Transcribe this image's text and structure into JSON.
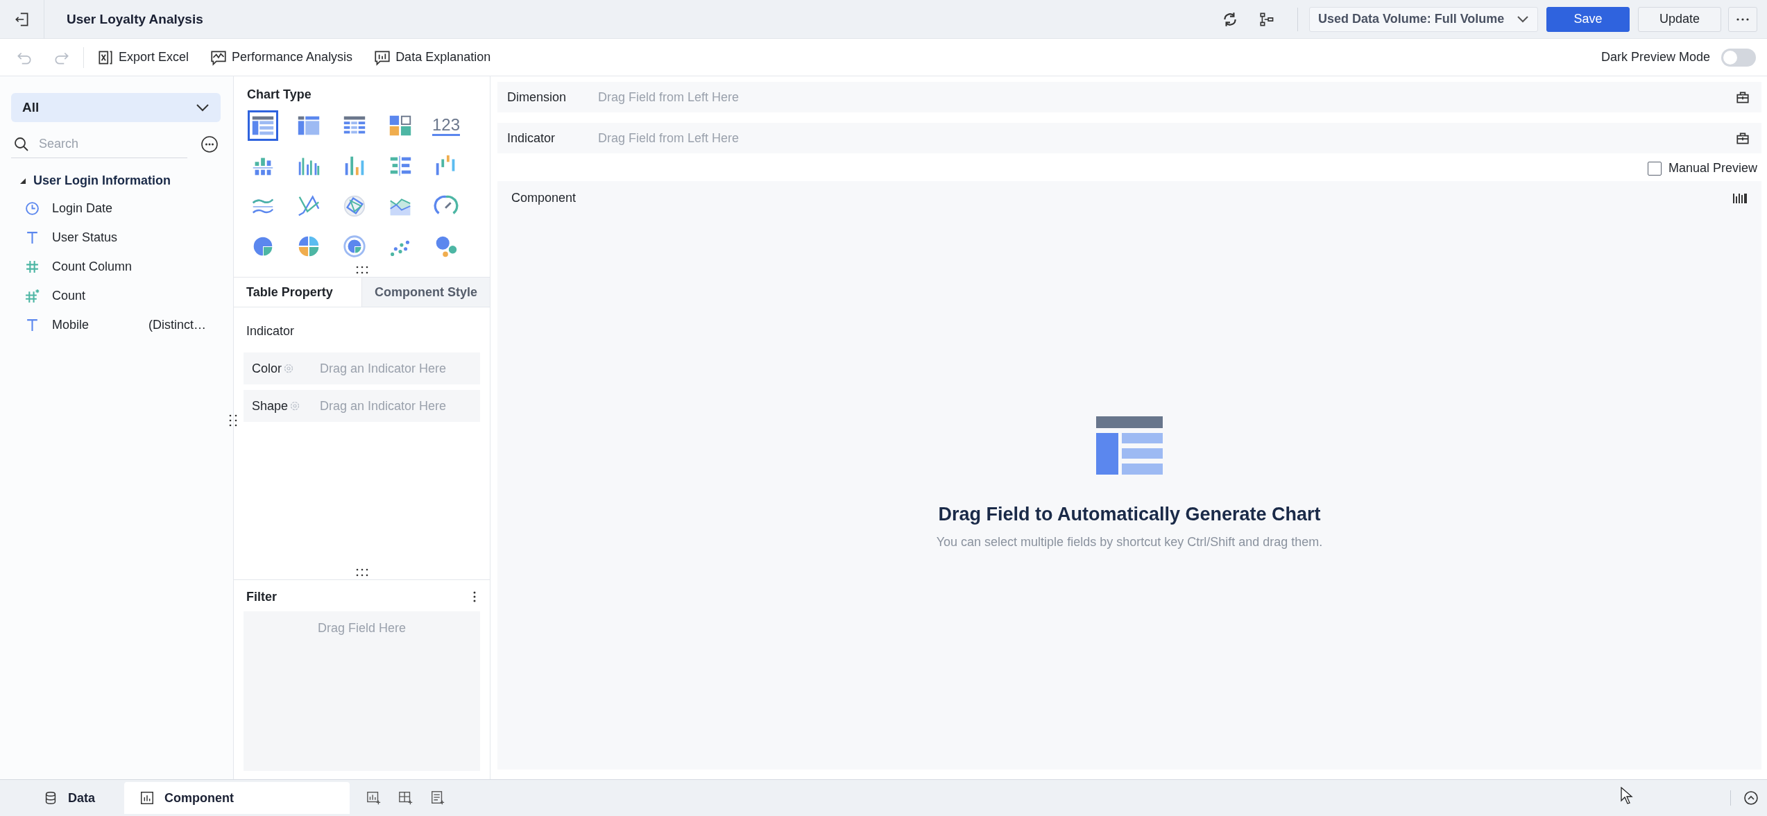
{
  "header": {
    "title": "User Loyalty Analysis",
    "volume_select": "Used Data Volume: Full Volume",
    "buttons": [
      {
        "label": "Save",
        "kind": "primary"
      },
      {
        "label": "Update",
        "kind": "secondary"
      }
    ]
  },
  "toolbar": {
    "actions": [
      {
        "label": "Export Excel",
        "kind": "excel"
      },
      {
        "label": "Performance Analysis",
        "kind": "performance"
      },
      {
        "label": "Data Explanation",
        "kind": "explanation"
      }
    ],
    "dark_preview": {
      "label": "Dark Preview Mode",
      "on": false
    }
  },
  "data_panel": {
    "select": "All",
    "search": {
      "placeholder": "Search"
    },
    "tree": {
      "label": "User Login Information",
      "expanded": true,
      "children": [
        {
          "label": "Login Date",
          "kind": "date"
        },
        {
          "label": "User Status",
          "kind": "text"
        },
        {
          "label": "Count Column",
          "kind": "number"
        },
        {
          "label": "Count",
          "kind": "count"
        },
        {
          "label": "Mobile",
          "kind": "text",
          "note": "(Distinct…"
        }
      ]
    }
  },
  "chart_panel": {
    "title": "Chart Type",
    "types": [
      {
        "kind": "table",
        "selected": true
      },
      {
        "kind": "cross-table",
        "selected": false
      },
      {
        "kind": "detail-table",
        "selected": false
      },
      {
        "kind": "block",
        "selected": false
      },
      {
        "kind": "number",
        "label": "123",
        "selected": false
      },
      {
        "kind": "stacked-bar",
        "selected": false
      },
      {
        "kind": "grouped-bar",
        "selected": false
      },
      {
        "kind": "bar",
        "selected": false
      },
      {
        "kind": "horizontal-bar",
        "selected": false
      },
      {
        "kind": "waterfall",
        "selected": false
      },
      {
        "kind": "line",
        "selected": false
      },
      {
        "kind": "multi-line",
        "selected": false
      },
      {
        "kind": "radar",
        "selected": false
      },
      {
        "kind": "area",
        "selected": false
      },
      {
        "kind": "gauge",
        "selected": false
      },
      {
        "kind": "pie",
        "selected": false
      },
      {
        "kind": "multi-pie",
        "selected": false
      },
      {
        "kind": "ring",
        "selected": false
      },
      {
        "kind": "scatter",
        "selected": false
      },
      {
        "kind": "bubble",
        "selected": false
      }
    ],
    "tabs": [
      {
        "label": "Table Property",
        "selected": true
      },
      {
        "label": "Component Style",
        "selected": false
      }
    ],
    "indicator_label": "Indicator",
    "slots": [
      {
        "label": "Color",
        "placeholder": "Drag an Indicator Here"
      },
      {
        "label": "Shape",
        "placeholder": "Drag an Indicator Here"
      }
    ],
    "filter": {
      "title": "Filter",
      "placeholder": "Drag Field Here"
    }
  },
  "editor": {
    "rows": [
      {
        "label": "Dimension",
        "placeholder": "Drag Field from Left Here"
      },
      {
        "label": "Indicator",
        "placeholder": "Drag Field from Left Here"
      }
    ],
    "manual_preview": {
      "label": "Manual Preview",
      "checked": false
    },
    "component": {
      "title": "Component",
      "empty_title": "Drag Field to Automatically Generate Chart",
      "empty_hint": "You can select multiple fields by shortcut key Ctrl/Shift and drag them."
    }
  },
  "bottom_tabs": [
    {
      "label": "Data",
      "kind": "data",
      "selected": false
    },
    {
      "label": "Component",
      "kind": "component",
      "selected": true
    }
  ]
}
